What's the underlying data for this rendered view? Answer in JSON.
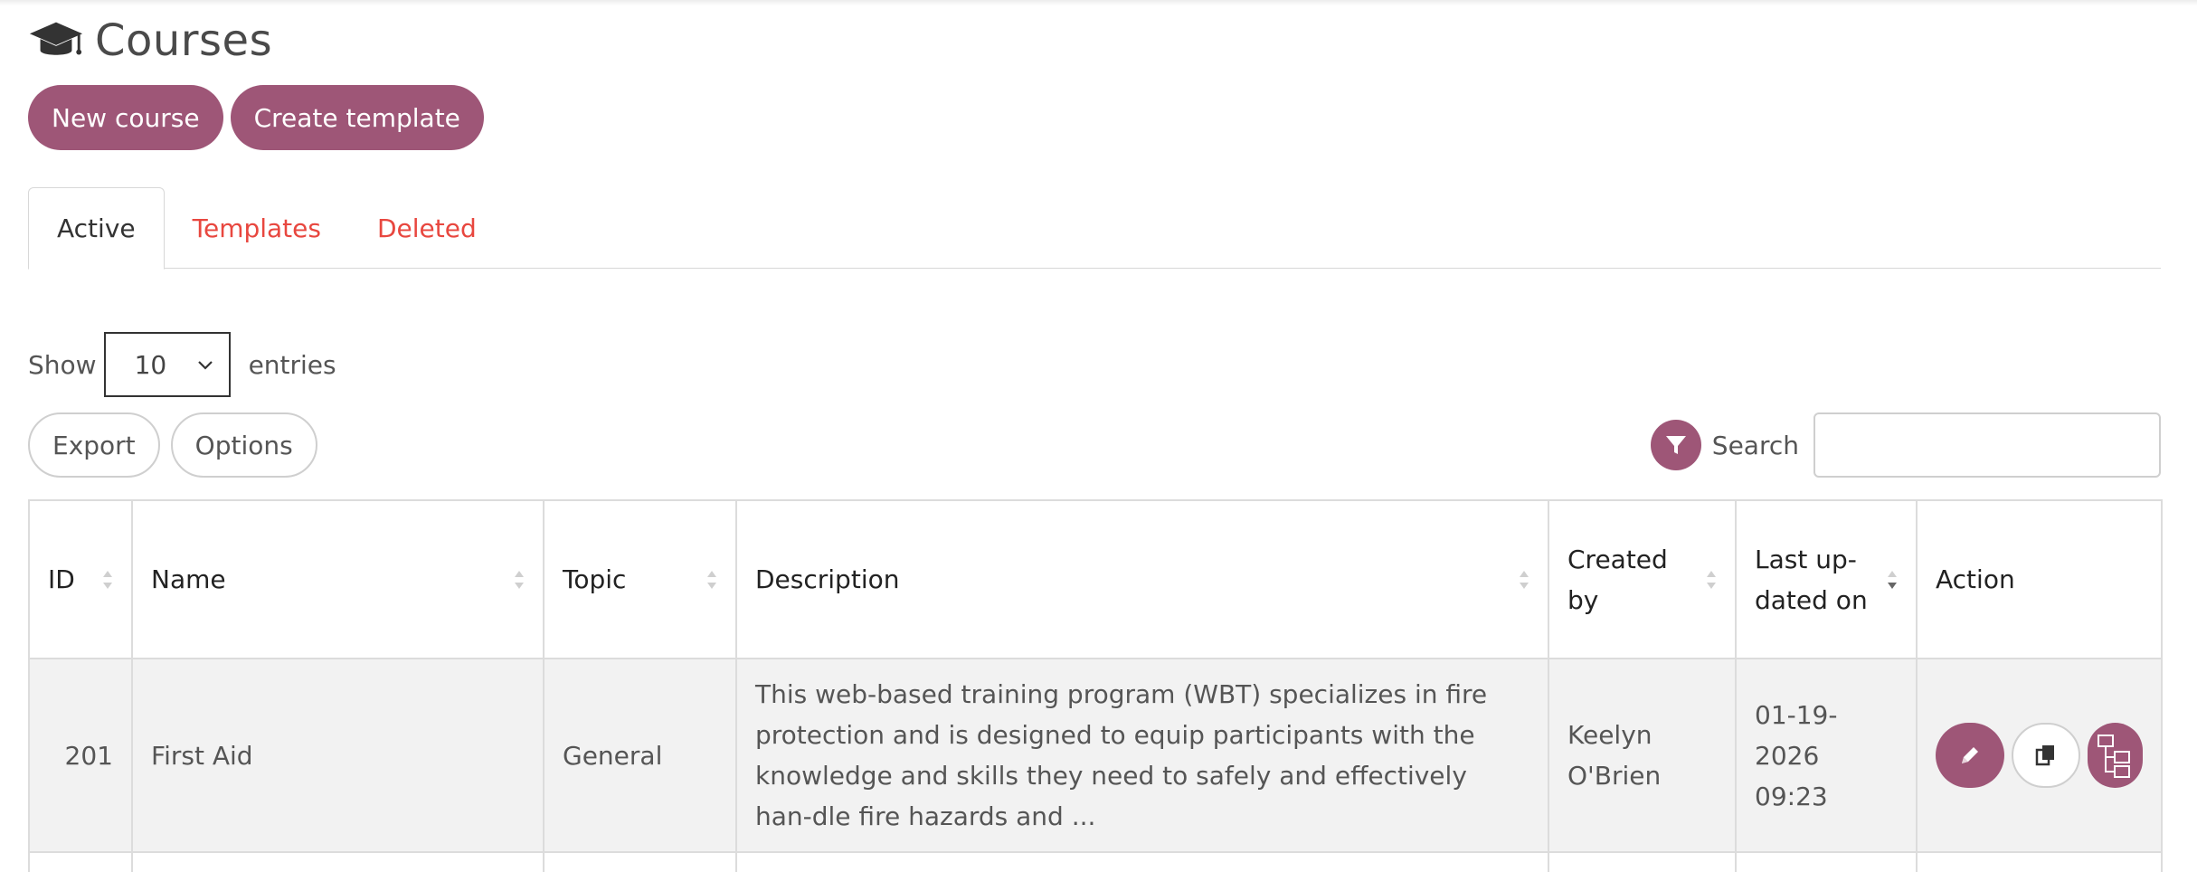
{
  "header": {
    "title": "Courses",
    "icon": "graduation-cap-icon"
  },
  "buttons": {
    "new_course": "New course",
    "create_template": "Create template"
  },
  "tabs": [
    {
      "label": "Active",
      "active": true
    },
    {
      "label": "Templates",
      "active": false
    },
    {
      "label": "Deleted",
      "active": false
    }
  ],
  "length": {
    "show": "Show",
    "value": "10",
    "entries": "entries"
  },
  "tools": {
    "export": "Export",
    "options": "Options"
  },
  "search": {
    "label": "Search",
    "value": ""
  },
  "columns": [
    "ID",
    "Name",
    "Topic",
    "Description",
    "Created by",
    "Last up-dated on",
    "Action"
  ],
  "rows": [
    {
      "id": "201",
      "name": "First Aid",
      "topic": "General",
      "description": "This web-based training program (WBT) specializes in fire protection and is designed to equip participants with the knowledge and skills they need to safely and effectively han-dle fire hazards and ...",
      "created_by": "Keelyn O'Brien",
      "last_updated": "01-19-2026 09:23"
    }
  ],
  "colors": {
    "accent": "#9e5677",
    "tab_link": "#e8473f"
  }
}
